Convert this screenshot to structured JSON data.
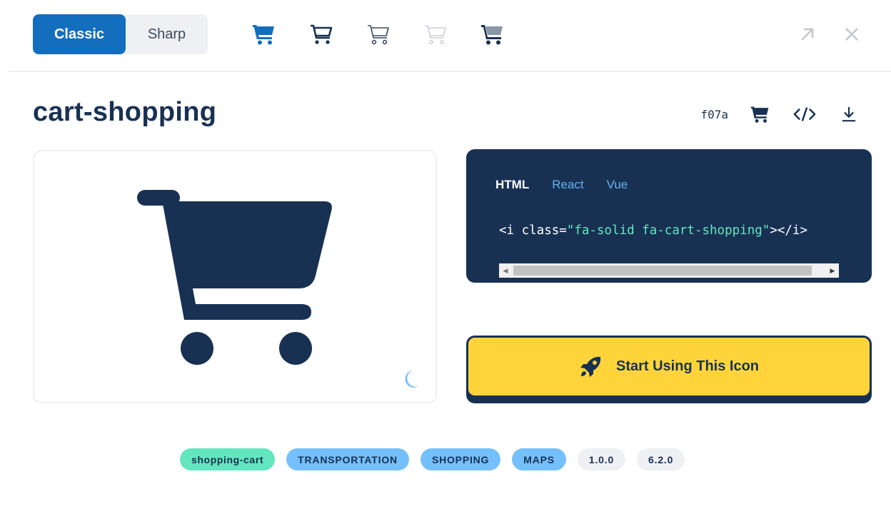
{
  "style_toggle": {
    "classic": "Classic",
    "sharp": "Sharp"
  },
  "variants": [
    {
      "icon": "cart-solid-icon",
      "color": "#146ebe"
    },
    {
      "icon": "cart-regular-icon",
      "color": "#183153"
    },
    {
      "icon": "cart-light-icon",
      "color": "#3b4a60"
    },
    {
      "icon": "cart-thin-icon",
      "color": "#b0b7c3"
    },
    {
      "icon": "cart-duotone-icon",
      "color": "#183153"
    }
  ],
  "title": "cart-shopping",
  "unicode": "f07a",
  "code": {
    "tabs": [
      "HTML",
      "React",
      "Vue"
    ],
    "prefix": "<i class=",
    "string": "\"fa-solid fa-cart-shopping\"",
    "suffix": "></i>"
  },
  "cta_label": "Start Using This Icon",
  "tags": [
    "shopping-cart",
    "TRANSPORTATION",
    "SHOPPING",
    "MAPS",
    "1.0.0",
    "6.2.0"
  ],
  "colors": {
    "brand_blue": "#146ebe",
    "navy": "#183153",
    "yellow": "#ffd43b",
    "tag_green": "#63e6be",
    "tag_blue": "#74c0fc"
  }
}
